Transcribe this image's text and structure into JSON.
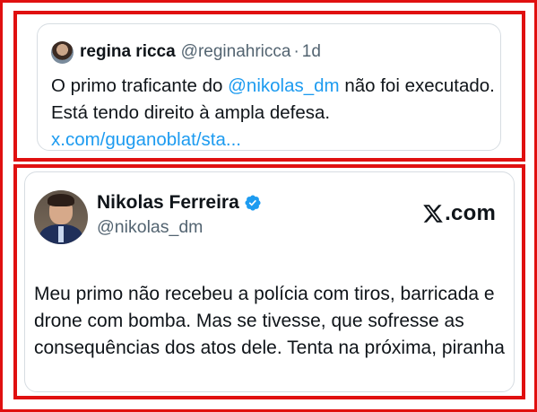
{
  "quote": {
    "name": "regina ricca",
    "handle": "@reginahricca",
    "separator": "·",
    "time": "1d",
    "text_part1": "O primo traficante do ",
    "mention": "@nikolas_dm",
    "text_part2": " não foi executado. Está tendo direito à ampla defesa. ",
    "link": "x.com/guganoblat/sta..."
  },
  "post": {
    "name": "Nikolas Ferreira",
    "handle": "@nikolas_dm",
    "brand": ".com",
    "text": "Meu primo não recebeu a polícia com tiros, barricada e drone com bomba. Mas se tivesse, que sofresse as consequências dos atos dele. Tenta na próxima, piranha"
  },
  "icons": {
    "verified": "verified-badge-icon",
    "x_logo": "x-logo-icon"
  },
  "colors": {
    "frame": "#e01010",
    "link": "#1d9bf0",
    "verified": "#1d9bf0",
    "text": "#0f1419",
    "muted": "#536471"
  }
}
